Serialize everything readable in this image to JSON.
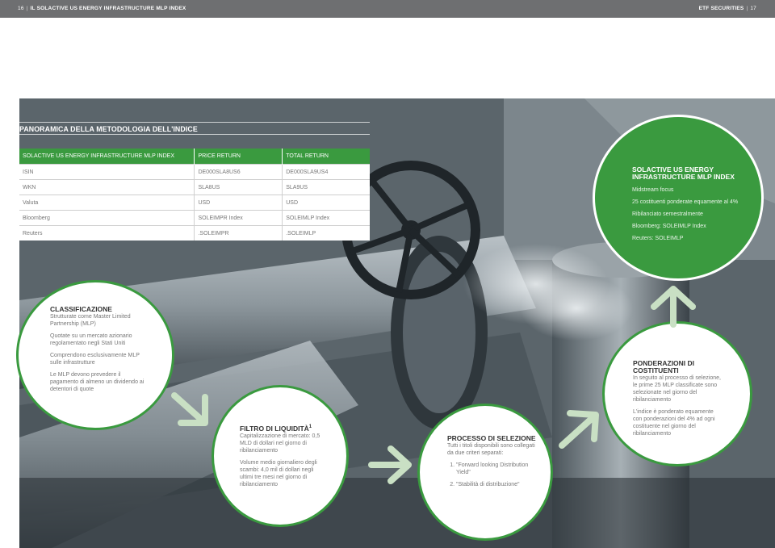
{
  "header": {
    "page_left": "16",
    "doc_title": "IL SOLACTIVE US ENERGY INFRASTRUCTURE MLP INDEX",
    "brand": "ETF SECURITIES",
    "page_right": "17"
  },
  "section_title": "PANORAMICA DELLA METODOLOGIA DELL'INDICE",
  "table": {
    "headers": [
      "SOLACTIVE US ENERGY INFRASTRUCTURE MLP INDEX",
      "PRICE RETURN",
      "TOTAL RETURN"
    ],
    "rows": [
      [
        "ISIN",
        "DE000SLA8US6",
        "DE000SLA9US4"
      ],
      [
        "WKN",
        "SLA8US",
        "SLA9US"
      ],
      [
        "Valuta",
        "USD",
        "USD"
      ],
      [
        "Bloomberg",
        "SOLEIMPR Index",
        "SOLEIMLP Index"
      ],
      [
        "Reuters",
        ".SOLEIMPR",
        ".SOLEIMLP"
      ]
    ]
  },
  "circles": {
    "index": {
      "heading": "SOLACTIVE US ENERGY INFRASTRUCTURE MLP INDEX",
      "lines": [
        "Midstream focus",
        "25 costituenti ponderate equamente al 4%",
        "Ribilanciato semestralmente",
        "Bloomberg: SOLEIMLP Index",
        "Reuters: SOLEIMLP"
      ]
    },
    "classificazione": {
      "heading": "CLASSIFICAZIONE",
      "lines": [
        "Strutturate come Master Limited Partnership (MLP)",
        "Quotate su un mercato azionario regolamentato negli Stati Uniti",
        "Comprendono esclusivamente MLP sulle infrastrutture",
        "Le MLP devono prevedere il pagamento di almeno un dividendo ai detentori di quote"
      ]
    },
    "liquidita": {
      "heading": "FILTRO DI LIQUIDITÀ",
      "heading_sup": "1",
      "lines": [
        "Capitalizzazione di mercato: 0,5 MLD di dollari nel giorno di ribilanciamento",
        "Volume medio giornaliero degli scambi: 4,0 mil di dollari negli ultimi tre mesi nel giorno di ribilanciamento"
      ]
    },
    "selezione": {
      "heading": "PROCESSO DI SELEZIONE",
      "intro": "Tutti i titoli disponibili sono collegati da due criteri separati:",
      "items": [
        "\"Forward looking Distribution Yield\"",
        "\"Stabilità di distribuzione\""
      ]
    },
    "ponderazioni": {
      "heading": "PONDERAZIONI DI COSTITUENTI",
      "lines": [
        "In seguito al processo di selezione, le prime 25 MLP classificate sono selezionate nel giorno del ribilanciamento",
        "L'indice è ponderato equamente con ponderazioni del 4% ad ogni costituente nel giorno del ribilanciamento"
      ]
    }
  },
  "colors": {
    "accent_green": "#3a9a3f",
    "arrow_green": "#c9e0c4",
    "header_gray": "#6e6f71"
  }
}
